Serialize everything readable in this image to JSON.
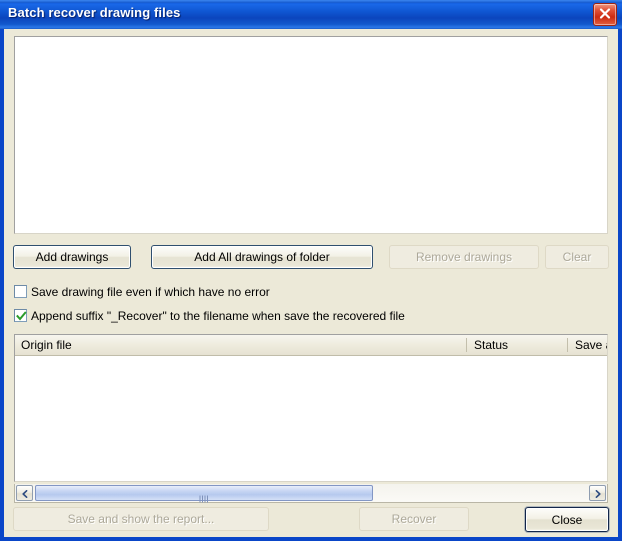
{
  "window": {
    "title": "Batch recover drawing files",
    "close_icon": "close-icon",
    "accent_color": "#0a46c8",
    "titlebar_color": "#0b4fd0",
    "face_color": "#ece9d8"
  },
  "drawing_list": {
    "items": [],
    "empty": true
  },
  "toolbar": {
    "add_drawings_label": "Add drawings",
    "add_all_folder_label": "Add All drawings of folder",
    "remove_drawings_label": "Remove drawings",
    "clear_label": "Clear"
  },
  "options": {
    "save_no_error": {
      "label": "Save drawing file even if which have no error",
      "checked": false
    },
    "append_suffix": {
      "label": "Append suffix \"_Recover\" to the filename when save the recovered file",
      "checked": true,
      "check_color": "#2a9c2a"
    }
  },
  "results": {
    "columns": [
      {
        "label": "Origin file"
      },
      {
        "label": "Status"
      },
      {
        "label": "Save as"
      }
    ],
    "rows": []
  },
  "scrollbar": {
    "left_arrow_icon": "chevron-left-icon",
    "right_arrow_icon": "chevron-right-icon",
    "grip_icon": "grip-icon"
  },
  "footer": {
    "save_report_label": "Save and show the report...",
    "recover_label": "Recover",
    "close_label": "Close"
  }
}
